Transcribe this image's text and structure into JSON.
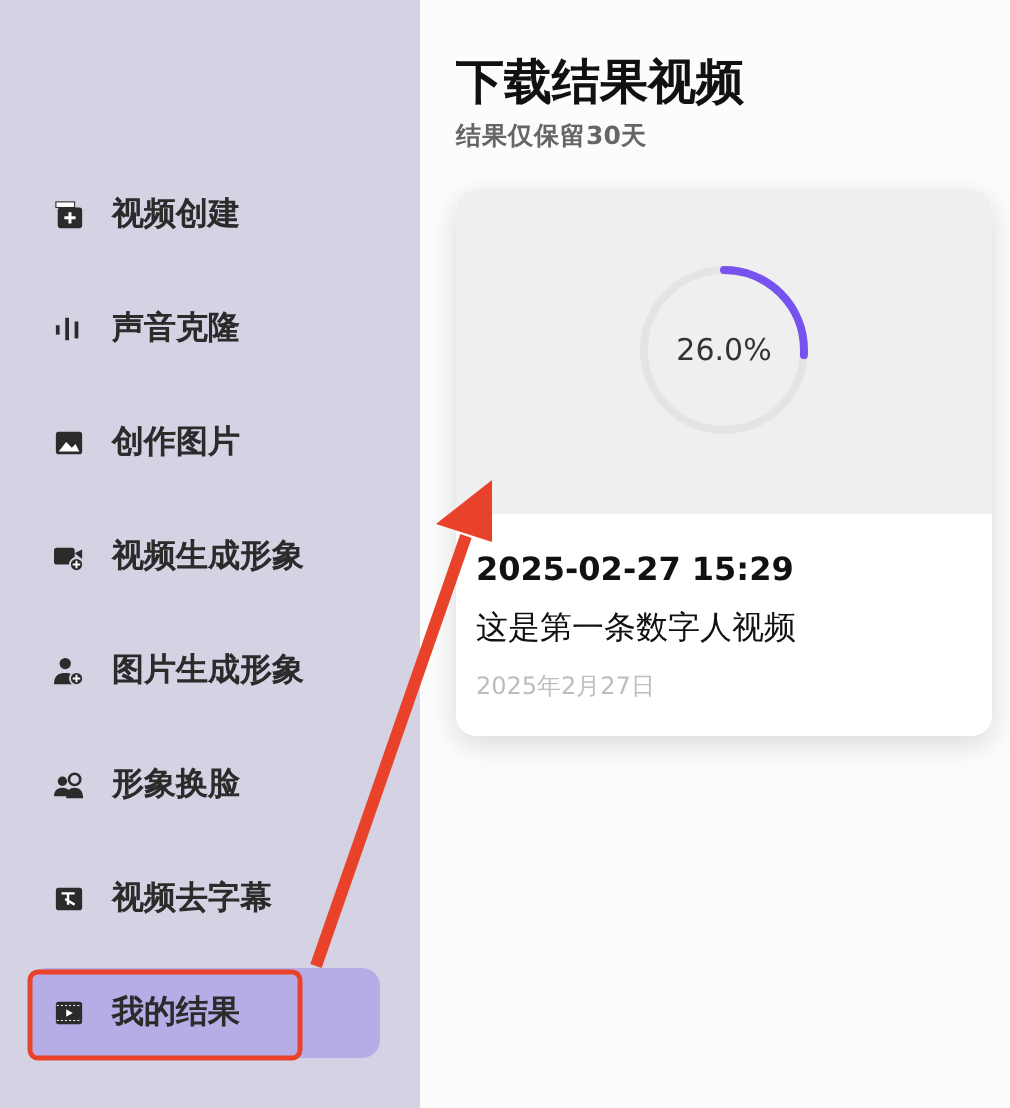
{
  "sidebar": {
    "items": [
      {
        "label": "视频创建",
        "selected": false
      },
      {
        "label": "声音克隆",
        "selected": false
      },
      {
        "label": "创作图片",
        "selected": false
      },
      {
        "label": "视频生成形象",
        "selected": false
      },
      {
        "label": "图片生成形象",
        "selected": false
      },
      {
        "label": "形象换脸",
        "selected": false
      },
      {
        "label": "视频去字幕",
        "selected": false
      },
      {
        "label": "我的结果",
        "selected": true
      }
    ]
  },
  "main": {
    "title": "下载结果视频",
    "subtitle": "结果仅保留30天",
    "results": [
      {
        "progress": {
          "level": 0.26,
          "reading": "26.0%"
        },
        "timestamp": "2025-02-27 15:29",
        "description": "这是第一条数字人视频",
        "date": "2025年2月27日"
      }
    ]
  }
}
